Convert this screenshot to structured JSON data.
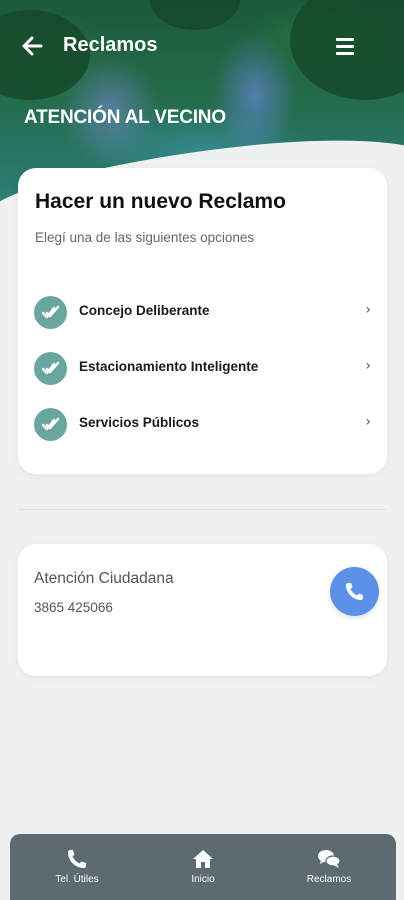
{
  "header": {
    "title": "Reclamos",
    "section_title": "ATENCIÓN AL VECINO",
    "back_icon": "arrow-left-icon",
    "menu_icon": "hamburger-menu-icon"
  },
  "new_claim_card": {
    "title": "Hacer un nuevo Reclamo",
    "subtitle": "Elegí una de las siguientes opciones",
    "options": [
      {
        "label": "Concejo Deliberante",
        "icon": "double-check-icon"
      },
      {
        "label": "Estacionamiento Inteligente",
        "icon": "double-check-icon"
      },
      {
        "label": "Servicios Públicos",
        "icon": "double-check-icon"
      }
    ],
    "chevron": "›"
  },
  "contact_card": {
    "title": "Atención Ciudadana",
    "phone": "3865 425066",
    "call_icon": "phone-icon"
  },
  "bottom_nav": {
    "items": [
      {
        "label": "Tel. Útiles",
        "icon": "phone-icon"
      },
      {
        "label": "Inicio",
        "icon": "home-icon"
      },
      {
        "label": "Reclamos",
        "icon": "chat-bubbles-icon"
      }
    ]
  },
  "colors": {
    "accent_teal": "#6aa6a0",
    "call_blue": "#5b91e6",
    "nav_bg": "#5c6a72",
    "page_bg": "#eef1f0"
  }
}
